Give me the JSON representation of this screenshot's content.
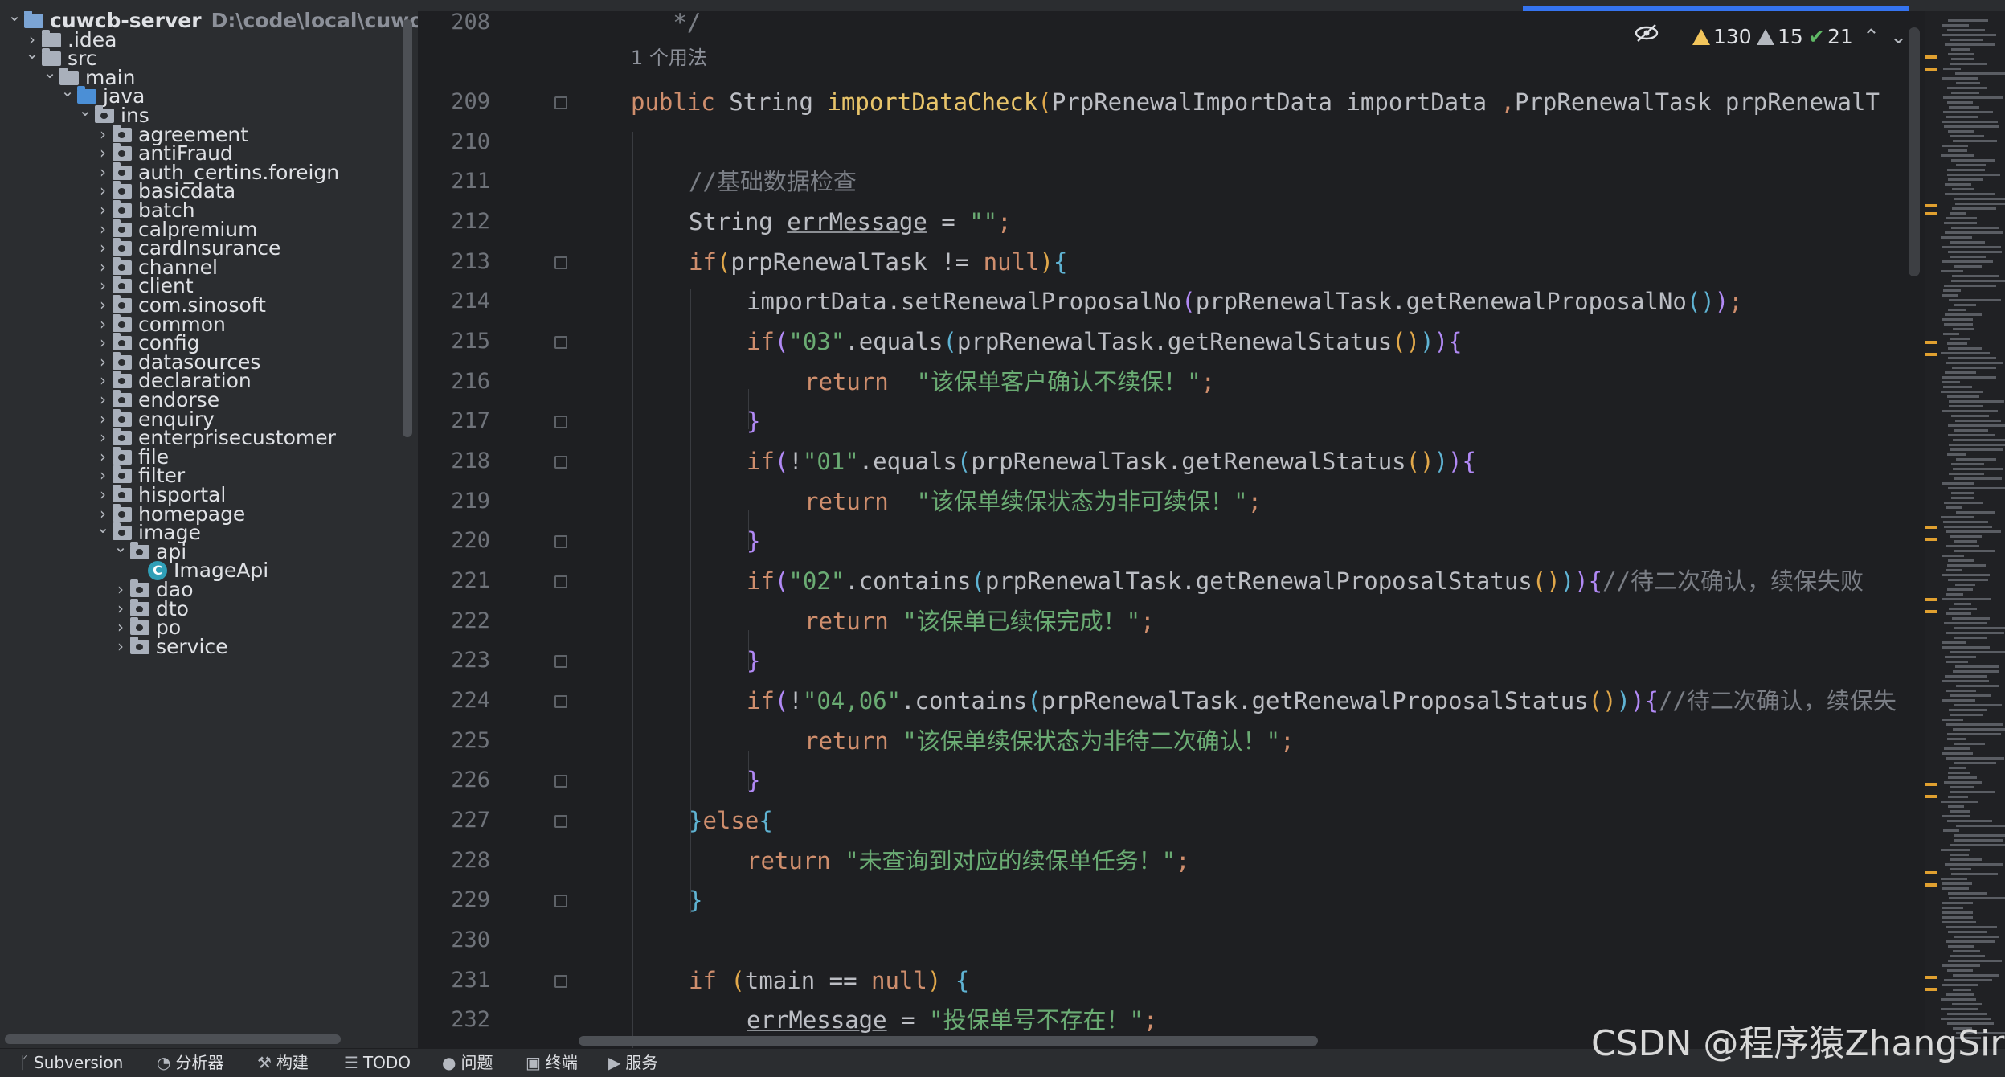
{
  "project": {
    "root_name": "cuwcb-server",
    "root_path": "D:\\code\\local\\cuwcb-se",
    "tree": [
      {
        "label": "cuwcb-server",
        "indent": 0,
        "expanded": true,
        "type": "module"
      },
      {
        "label": ".idea",
        "indent": 1,
        "expanded": false,
        "type": "folder"
      },
      {
        "label": "src",
        "indent": 1,
        "expanded": true,
        "type": "folder"
      },
      {
        "label": "main",
        "indent": 2,
        "expanded": true,
        "type": "folder"
      },
      {
        "label": "java",
        "indent": 3,
        "expanded": true,
        "type": "folder-blue"
      },
      {
        "label": "ins",
        "indent": 4,
        "expanded": true,
        "type": "pkg"
      },
      {
        "label": "agreement",
        "indent": 5,
        "expanded": false,
        "type": "pkg"
      },
      {
        "label": "antiFraud",
        "indent": 5,
        "expanded": false,
        "type": "pkg"
      },
      {
        "label": "auth_certins.foreign",
        "indent": 5,
        "expanded": false,
        "type": "pkg"
      },
      {
        "label": "basicdata",
        "indent": 5,
        "expanded": false,
        "type": "pkg"
      },
      {
        "label": "batch",
        "indent": 5,
        "expanded": false,
        "type": "pkg"
      },
      {
        "label": "calpremium",
        "indent": 5,
        "expanded": false,
        "type": "pkg"
      },
      {
        "label": "cardInsurance",
        "indent": 5,
        "expanded": false,
        "type": "pkg"
      },
      {
        "label": "channel",
        "indent": 5,
        "expanded": false,
        "type": "pkg"
      },
      {
        "label": "client",
        "indent": 5,
        "expanded": false,
        "type": "pkg"
      },
      {
        "label": "com.sinosoft",
        "indent": 5,
        "expanded": false,
        "type": "pkg"
      },
      {
        "label": "common",
        "indent": 5,
        "expanded": false,
        "type": "pkg"
      },
      {
        "label": "config",
        "indent": 5,
        "expanded": false,
        "type": "pkg"
      },
      {
        "label": "datasources",
        "indent": 5,
        "expanded": false,
        "type": "pkg"
      },
      {
        "label": "declaration",
        "indent": 5,
        "expanded": false,
        "type": "pkg"
      },
      {
        "label": "endorse",
        "indent": 5,
        "expanded": false,
        "type": "pkg"
      },
      {
        "label": "enquiry",
        "indent": 5,
        "expanded": false,
        "type": "pkg"
      },
      {
        "label": "enterprisecustomer",
        "indent": 5,
        "expanded": false,
        "type": "pkg"
      },
      {
        "label": "file",
        "indent": 5,
        "expanded": false,
        "type": "pkg"
      },
      {
        "label": "filter",
        "indent": 5,
        "expanded": false,
        "type": "pkg"
      },
      {
        "label": "hisportal",
        "indent": 5,
        "expanded": false,
        "type": "pkg"
      },
      {
        "label": "homepage",
        "indent": 5,
        "expanded": false,
        "type": "pkg"
      },
      {
        "label": "image",
        "indent": 5,
        "expanded": true,
        "type": "pkg"
      },
      {
        "label": "api",
        "indent": 6,
        "expanded": true,
        "type": "pkg"
      },
      {
        "label": "ImageApi",
        "indent": 7,
        "expanded": null,
        "type": "class"
      },
      {
        "label": "dao",
        "indent": 6,
        "expanded": false,
        "type": "pkg"
      },
      {
        "label": "dto",
        "indent": 6,
        "expanded": false,
        "type": "pkg"
      },
      {
        "label": "po",
        "indent": 6,
        "expanded": false,
        "type": "pkg"
      },
      {
        "label": "service",
        "indent": 6,
        "expanded": false,
        "type": "pkg"
      }
    ]
  },
  "editor": {
    "usage_hint": "1 个用法",
    "inspections": {
      "warnings": "130",
      "weak_warnings": "15",
      "ok": "21"
    },
    "line_numbers": [
      "208",
      "209",
      "210",
      "211",
      "212",
      "213",
      "214",
      "215",
      "216",
      "217",
      "218",
      "219",
      "220",
      "221",
      "222",
      "223",
      "224",
      "225",
      "226",
      "227",
      "228",
      "229",
      "230",
      "231",
      "232"
    ],
    "code": [
      {
        "n": "208",
        "indent": 0,
        "tokens": [
          {
            "t": "   */",
            "c": "cmt"
          }
        ]
      },
      {
        "n": "209",
        "indent": 0,
        "tokens": [
          {
            "t": "public ",
            "c": "kw"
          },
          {
            "t": "String ",
            "c": ""
          },
          {
            "t": "importDataCheck",
            "c": "meth"
          },
          {
            "t": "(",
            "c": "p1"
          },
          {
            "t": "PrpRenewalImportData importData ",
            "c": ""
          },
          {
            "t": ",",
            "c": "kw"
          },
          {
            "t": "PrpRenewalTask prpRenewalT",
            "c": ""
          }
        ]
      },
      {
        "n": "210",
        "indent": 0,
        "tokens": []
      },
      {
        "n": "211",
        "indent": 1,
        "tokens": [
          {
            "t": "//基础数据检查",
            "c": "cmt"
          }
        ]
      },
      {
        "n": "212",
        "indent": 1,
        "tokens": [
          {
            "t": "String ",
            "c": ""
          },
          {
            "t": "errMessage",
            "c": "uline"
          },
          {
            "t": " = ",
            "c": ""
          },
          {
            "t": "\"\"",
            "c": "str"
          },
          {
            "t": ";",
            "c": "kw"
          }
        ]
      },
      {
        "n": "213",
        "indent": 1,
        "tokens": [
          {
            "t": "if",
            "c": "kw"
          },
          {
            "t": "(",
            "c": "p1"
          },
          {
            "t": "prpRenewalTask != ",
            "c": ""
          },
          {
            "t": "null",
            "c": "kw"
          },
          {
            "t": ")",
            "c": "p1"
          },
          {
            "t": "{",
            "c": "p3"
          }
        ]
      },
      {
        "n": "214",
        "indent": 2,
        "tokens": [
          {
            "t": "importData.setRenewalProposalNo",
            "c": ""
          },
          {
            "t": "(",
            "c": "p2"
          },
          {
            "t": "prpRenewalTask.getRenewalProposalNo",
            "c": ""
          },
          {
            "t": "()",
            "c": "p3"
          },
          {
            "t": ")",
            "c": "p2"
          },
          {
            "t": ";",
            "c": "kw"
          }
        ]
      },
      {
        "n": "215",
        "indent": 2,
        "tokens": [
          {
            "t": "if",
            "c": "kw"
          },
          {
            "t": "(",
            "c": "p2"
          },
          {
            "t": "\"03\"",
            "c": "str"
          },
          {
            "t": ".equals",
            "c": ""
          },
          {
            "t": "(",
            "c": "p3"
          },
          {
            "t": "prpRenewalTask.getRenewalStatus",
            "c": ""
          },
          {
            "t": "()",
            "c": "p1"
          },
          {
            "t": ")",
            "c": "p3"
          },
          {
            "t": ")",
            "c": "p2"
          },
          {
            "t": "{",
            "c": "p2"
          }
        ]
      },
      {
        "n": "216",
        "indent": 3,
        "tokens": [
          {
            "t": "return ",
            "c": "kw"
          },
          {
            "t": " \"该保单客户确认不续保！\"",
            "c": "str"
          },
          {
            "t": ";",
            "c": "kw"
          }
        ]
      },
      {
        "n": "217",
        "indent": 2,
        "tokens": [
          {
            "t": "}",
            "c": "p2"
          }
        ]
      },
      {
        "n": "218",
        "indent": 2,
        "tokens": [
          {
            "t": "if",
            "c": "kw"
          },
          {
            "t": "(",
            "c": "p2"
          },
          {
            "t": "!",
            "c": ""
          },
          {
            "t": "\"01\"",
            "c": "str"
          },
          {
            "t": ".equals",
            "c": ""
          },
          {
            "t": "(",
            "c": "p3"
          },
          {
            "t": "prpRenewalTask.getRenewalStatus",
            "c": ""
          },
          {
            "t": "()",
            "c": "p1"
          },
          {
            "t": ")",
            "c": "p3"
          },
          {
            "t": ")",
            "c": "p2"
          },
          {
            "t": "{",
            "c": "p2"
          }
        ]
      },
      {
        "n": "219",
        "indent": 3,
        "tokens": [
          {
            "t": "return ",
            "c": "kw"
          },
          {
            "t": " \"该保单续保状态为非可续保！\"",
            "c": "str"
          },
          {
            "t": ";",
            "c": "kw"
          }
        ]
      },
      {
        "n": "220",
        "indent": 2,
        "tokens": [
          {
            "t": "}",
            "c": "p2"
          }
        ]
      },
      {
        "n": "221",
        "indent": 2,
        "tokens": [
          {
            "t": "if",
            "c": "kw"
          },
          {
            "t": "(",
            "c": "p2"
          },
          {
            "t": "\"02\"",
            "c": "str"
          },
          {
            "t": ".contains",
            "c": ""
          },
          {
            "t": "(",
            "c": "p3"
          },
          {
            "t": "prpRenewalTask.getRenewalProposalStatus",
            "c": ""
          },
          {
            "t": "()",
            "c": "p1"
          },
          {
            "t": ")",
            "c": "p3"
          },
          {
            "t": ")",
            "c": "p2"
          },
          {
            "t": "{",
            "c": "p2"
          },
          {
            "t": "//待二次确认，续保失败",
            "c": "cmt"
          }
        ]
      },
      {
        "n": "222",
        "indent": 3,
        "tokens": [
          {
            "t": "return ",
            "c": "kw"
          },
          {
            "t": "\"该保单已续保完成！\"",
            "c": "str"
          },
          {
            "t": ";",
            "c": "kw"
          }
        ]
      },
      {
        "n": "223",
        "indent": 2,
        "tokens": [
          {
            "t": "}",
            "c": "p2"
          }
        ]
      },
      {
        "n": "224",
        "indent": 2,
        "tokens": [
          {
            "t": "if",
            "c": "kw"
          },
          {
            "t": "(",
            "c": "p2"
          },
          {
            "t": "!",
            "c": ""
          },
          {
            "t": "\"04,06\"",
            "c": "str"
          },
          {
            "t": ".contains",
            "c": ""
          },
          {
            "t": "(",
            "c": "p3"
          },
          {
            "t": "prpRenewalTask.getRenewalProposalStatus",
            "c": ""
          },
          {
            "t": "()",
            "c": "p1"
          },
          {
            "t": ")",
            "c": "p3"
          },
          {
            "t": ")",
            "c": "p2"
          },
          {
            "t": "{",
            "c": "p2"
          },
          {
            "t": "//待二次确认，续保失",
            "c": "cmt"
          }
        ]
      },
      {
        "n": "225",
        "indent": 3,
        "tokens": [
          {
            "t": "return ",
            "c": "kw"
          },
          {
            "t": "\"该保单续保状态为非待二次确认！\"",
            "c": "str"
          },
          {
            "t": ";",
            "c": "kw"
          }
        ]
      },
      {
        "n": "226",
        "indent": 2,
        "tokens": [
          {
            "t": "}",
            "c": "p2"
          }
        ]
      },
      {
        "n": "227",
        "indent": 1,
        "tokens": [
          {
            "t": "}",
            "c": "p3"
          },
          {
            "t": "else",
            "c": "kw"
          },
          {
            "t": "{",
            "c": "p3"
          }
        ]
      },
      {
        "n": "228",
        "indent": 2,
        "tokens": [
          {
            "t": "return ",
            "c": "kw"
          },
          {
            "t": "\"未查询到对应的续保单任务！\"",
            "c": "str"
          },
          {
            "t": ";",
            "c": "kw"
          }
        ]
      },
      {
        "n": "229",
        "indent": 1,
        "tokens": [
          {
            "t": "}",
            "c": "p3"
          }
        ]
      },
      {
        "n": "230",
        "indent": 0,
        "tokens": []
      },
      {
        "n": "231",
        "indent": 1,
        "tokens": [
          {
            "t": "if ",
            "c": "kw"
          },
          {
            "t": "(",
            "c": "p1"
          },
          {
            "t": "tmain == ",
            "c": ""
          },
          {
            "t": "null",
            "c": "kw"
          },
          {
            "t": ") ",
            "c": "p1"
          },
          {
            "t": "{",
            "c": "p3"
          }
        ]
      },
      {
        "n": "232",
        "indent": 2,
        "tokens": [
          {
            "t": "errMessage",
            "c": "uline"
          },
          {
            "t": " = ",
            "c": ""
          },
          {
            "t": "\"投保单号不存在！\"",
            "c": "str"
          },
          {
            "t": ";",
            "c": "kw"
          }
        ]
      }
    ]
  },
  "statusbar": [
    {
      "label": "Subversion",
      "icon": "branch-icon"
    },
    {
      "label": "分析器",
      "icon": "profiler-icon"
    },
    {
      "label": "构建",
      "icon": "hammer-icon"
    },
    {
      "label": "TODO",
      "icon": "list-icon"
    },
    {
      "label": "问题",
      "icon": "problems-icon"
    },
    {
      "label": "终端",
      "icon": "terminal-icon"
    },
    {
      "label": "服务",
      "icon": "services-icon"
    }
  ],
  "watermark": "CSDN @程序猿ZhangSir",
  "colors": {
    "background": "#1e1f22",
    "panel": "#2b2d30",
    "keyword": "#cf8e6d",
    "string": "#6aab73",
    "comment": "#7a7e85",
    "method": "#e8c46a",
    "accent": "#3574f0"
  }
}
